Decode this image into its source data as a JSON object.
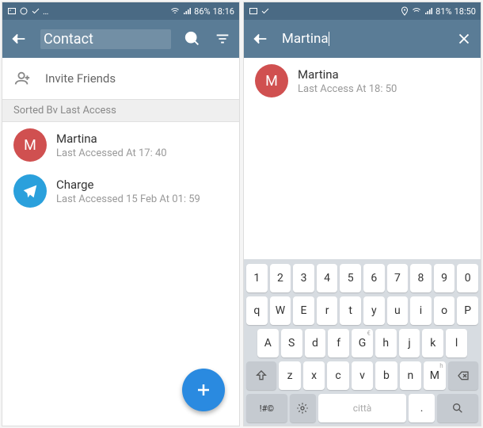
{
  "left": {
    "status": {
      "battery": "86%",
      "time": "18:16"
    },
    "header": {
      "title": "Contact"
    },
    "invite": {
      "label": "Invite Friends"
    },
    "section": {
      "label": "Sorted Bv Last Access"
    },
    "contacts": [
      {
        "initial": "M",
        "name": "Martina",
        "sub": "Last Accessed At 17: 40"
      },
      {
        "initial": "",
        "name": "Charge",
        "sub": "Last Accessed 15 Feb At 01: 59"
      }
    ]
  },
  "right": {
    "status": {
      "battery": "81%",
      "time": "18:50"
    },
    "header": {
      "search_value": "Martina"
    },
    "results": [
      {
        "initial": "M",
        "name": "Martina",
        "sub": "Last Access At 18: 50"
      }
    ],
    "keyboard": {
      "row1": [
        "1",
        "2",
        "3",
        "4",
        "5",
        "6",
        "7",
        "8",
        "9",
        "0"
      ],
      "row2": [
        "q",
        "W",
        "E",
        "r",
        "t",
        "y",
        "u",
        "i",
        "o",
        "P"
      ],
      "row2_sub": [
        "",
        "",
        "",
        "",
        "",
        "",
        "",
        "",
        "",
        ""
      ],
      "row3": [
        "A",
        "S",
        "d",
        "f",
        "G",
        "h",
        "j",
        "k",
        "l"
      ],
      "row3_sub": [
        "",
        "",
        "",
        "",
        "€",
        "",
        "",
        "",
        ""
      ],
      "row4": [
        "z",
        "x",
        "c",
        "v",
        "b",
        "n",
        "M"
      ],
      "row4_sub": [
        "",
        "",
        "",
        "",
        "",
        "",
        "h"
      ],
      "row5": {
        "sym": "!#©",
        "space": "città",
        "dot": "."
      }
    }
  }
}
